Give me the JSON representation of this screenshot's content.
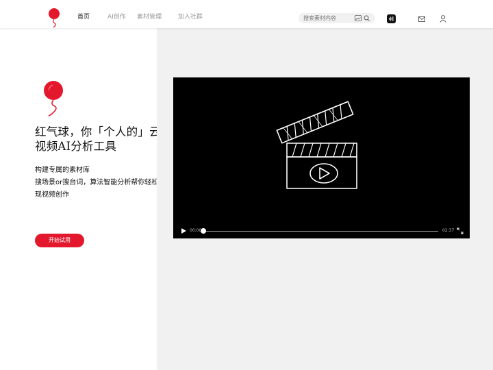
{
  "header": {
    "nav": [
      {
        "label": "首页",
        "active": true
      },
      {
        "label": "AI创作",
        "active": false
      },
      {
        "label": "素材管理",
        "active": false
      },
      {
        "label": "加入社群",
        "active": false
      }
    ],
    "search": {
      "placeholder": "搜索素材内容"
    },
    "icons": [
      "balloon-logo-icon",
      "image-search-icon",
      "search-icon",
      "audio-wave-icon",
      "mail-icon",
      "user-icon"
    ]
  },
  "hero": {
    "headline": "红气球，你「个人的」云上视频AI分析工具",
    "desc_line1": "构建专属的素材库",
    "desc_line2": "搜场景or搜台词，算法智能分析帮你轻松实现视频创作",
    "cta_label": "开始试用"
  },
  "video": {
    "current_time": "00:00",
    "duration": "02:37",
    "progress": 0.0
  },
  "colors": {
    "brand_red": "#e3182d",
    "video_bg": "#000000",
    "panel_bg": "#f1f1f1"
  }
}
